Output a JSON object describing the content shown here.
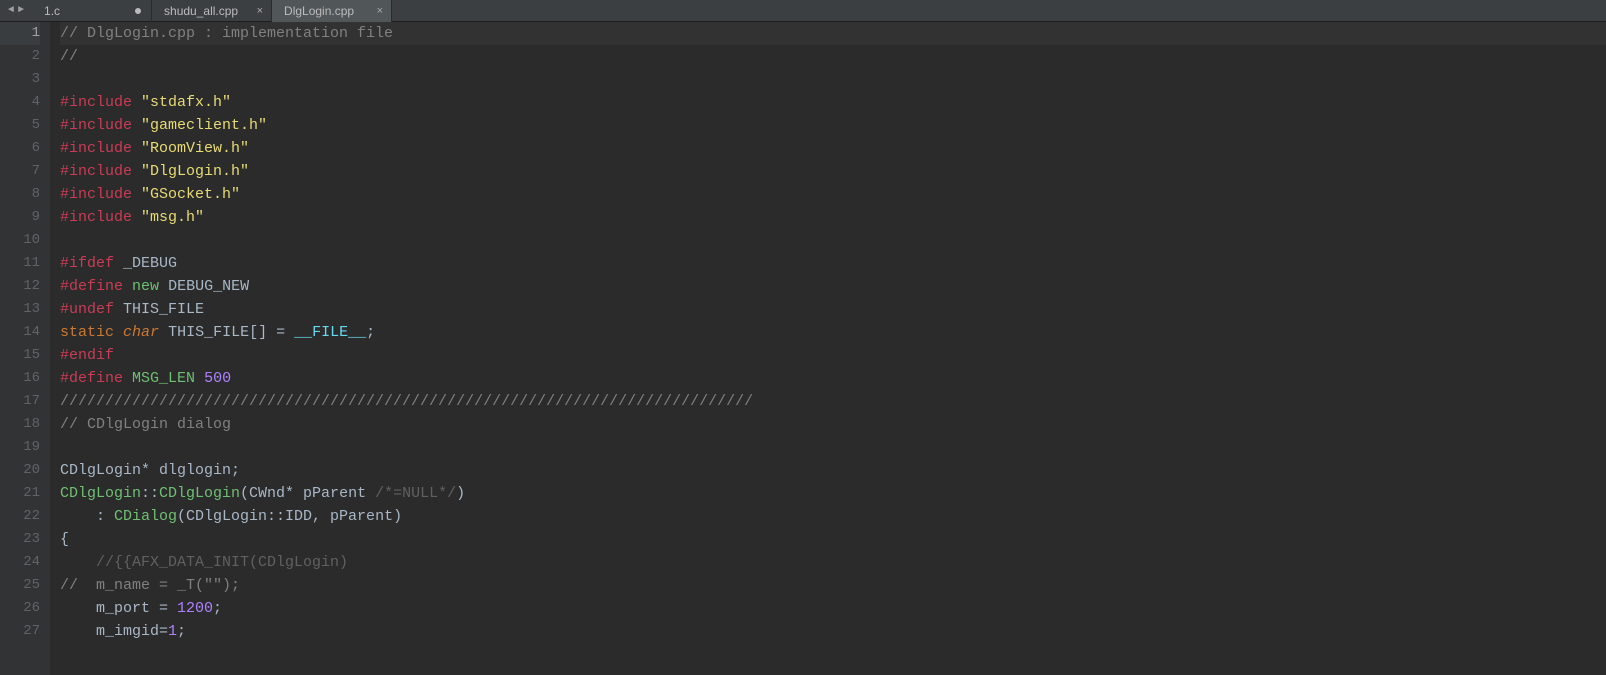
{
  "tabs": [
    {
      "label": "1.c",
      "modified": true,
      "active": false
    },
    {
      "label": "shudu_all.cpp",
      "modified": false,
      "active": false,
      "closable": true
    },
    {
      "label": "DlgLogin.cpp",
      "modified": false,
      "active": true,
      "closable": true
    }
  ],
  "code": {
    "lines": [
      {
        "n": 1,
        "tokens": [
          {
            "t": "// DlgLogin.cpp : implementation file",
            "c": "c-comment"
          }
        ],
        "active": true
      },
      {
        "n": 2,
        "tokens": [
          {
            "t": "//",
            "c": "c-comment"
          }
        ]
      },
      {
        "n": 3,
        "tokens": []
      },
      {
        "n": 4,
        "tokens": [
          {
            "t": "#include",
            "c": "c-preproc"
          },
          {
            "t": " ",
            "c": ""
          },
          {
            "t": "\"stdafx.h\"",
            "c": "c-string"
          }
        ]
      },
      {
        "n": 5,
        "tokens": [
          {
            "t": "#include",
            "c": "c-preproc"
          },
          {
            "t": " ",
            "c": ""
          },
          {
            "t": "\"gameclient.h\"",
            "c": "c-string"
          }
        ]
      },
      {
        "n": 6,
        "tokens": [
          {
            "t": "#include",
            "c": "c-preproc"
          },
          {
            "t": " ",
            "c": ""
          },
          {
            "t": "\"RoomView.h\"",
            "c": "c-string"
          }
        ]
      },
      {
        "n": 7,
        "tokens": [
          {
            "t": "#include",
            "c": "c-preproc"
          },
          {
            "t": " ",
            "c": ""
          },
          {
            "t": "\"DlgLogin.h\"",
            "c": "c-string"
          }
        ]
      },
      {
        "n": 8,
        "tokens": [
          {
            "t": "#include",
            "c": "c-preproc"
          },
          {
            "t": " ",
            "c": ""
          },
          {
            "t": "\"GSocket.h\"",
            "c": "c-string"
          }
        ]
      },
      {
        "n": 9,
        "tokens": [
          {
            "t": "#include",
            "c": "c-preproc"
          },
          {
            "t": " ",
            "c": ""
          },
          {
            "t": "\"msg.h\"",
            "c": "c-string"
          }
        ]
      },
      {
        "n": 10,
        "tokens": []
      },
      {
        "n": 11,
        "tokens": [
          {
            "t": "#ifdef",
            "c": "c-preproc"
          },
          {
            "t": " ",
            "c": ""
          },
          {
            "t": "_DEBUG",
            "c": "c-ident"
          }
        ]
      },
      {
        "n": 12,
        "tokens": [
          {
            "t": "#define",
            "c": "c-preproc"
          },
          {
            "t": " ",
            "c": ""
          },
          {
            "t": "new",
            "c": "c-define-name"
          },
          {
            "t": " ",
            "c": ""
          },
          {
            "t": "DEBUG_NEW",
            "c": "c-ident"
          }
        ]
      },
      {
        "n": 13,
        "tokens": [
          {
            "t": "#undef",
            "c": "c-preproc"
          },
          {
            "t": " ",
            "c": ""
          },
          {
            "t": "THIS_FILE",
            "c": "c-ident"
          }
        ]
      },
      {
        "n": 14,
        "tokens": [
          {
            "t": "static",
            "c": "c-keyword"
          },
          {
            "t": " ",
            "c": ""
          },
          {
            "t": "char",
            "c": "c-keyword-it"
          },
          {
            "t": " ",
            "c": ""
          },
          {
            "t": "THIS_FILE[] = ",
            "c": "c-ident"
          },
          {
            "t": "__FILE__",
            "c": "c-special"
          },
          {
            "t": ";",
            "c": "c-ident"
          }
        ]
      },
      {
        "n": 15,
        "tokens": [
          {
            "t": "#endif",
            "c": "c-preproc"
          }
        ]
      },
      {
        "n": 16,
        "tokens": [
          {
            "t": "#define",
            "c": "c-preproc"
          },
          {
            "t": " ",
            "c": ""
          },
          {
            "t": "MSG_LEN",
            "c": "c-define-name"
          },
          {
            "t": " ",
            "c": ""
          },
          {
            "t": "500",
            "c": "c-number"
          }
        ]
      },
      {
        "n": 17,
        "tokens": [
          {
            "t": "/////////////////////////////////////////////////////////////////////////////",
            "c": "c-comment"
          }
        ]
      },
      {
        "n": 18,
        "tokens": [
          {
            "t": "// CDlgLogin dialog",
            "c": "c-comment"
          }
        ]
      },
      {
        "n": 19,
        "tokens": []
      },
      {
        "n": 20,
        "tokens": [
          {
            "t": "CDlgLogin* dlglogin;",
            "c": "c-ident"
          }
        ]
      },
      {
        "n": 21,
        "tokens": [
          {
            "t": "CDlgLogin",
            "c": "c-type"
          },
          {
            "t": "::",
            "c": "c-ident"
          },
          {
            "t": "CDlgLogin",
            "c": "c-type"
          },
          {
            "t": "(CWnd* pParent ",
            "c": "c-ident"
          },
          {
            "t": "/*=NULL*/",
            "c": "c-comment-dim"
          },
          {
            "t": ")",
            "c": "c-ident"
          }
        ]
      },
      {
        "n": 22,
        "tokens": [
          {
            "t": "    : ",
            "c": "c-ident"
          },
          {
            "t": "CDialog",
            "c": "c-type"
          },
          {
            "t": "(CDlgLogin::IDD, pParent)",
            "c": "c-ident"
          }
        ]
      },
      {
        "n": 23,
        "tokens": [
          {
            "t": "{",
            "c": "c-ident"
          }
        ]
      },
      {
        "n": 24,
        "tokens": [
          {
            "t": "    ",
            "c": ""
          },
          {
            "t": "//{{AFX_DATA_INIT(CDlgLogin)",
            "c": "c-comment-dim"
          }
        ]
      },
      {
        "n": 25,
        "tokens": [
          {
            "t": "//  m_name = _T(\"\");",
            "c": "c-comment"
          }
        ]
      },
      {
        "n": 26,
        "tokens": [
          {
            "t": "    m_port = ",
            "c": "c-ident"
          },
          {
            "t": "1200",
            "c": "c-number"
          },
          {
            "t": ";",
            "c": "c-ident"
          }
        ]
      },
      {
        "n": 27,
        "tokens": [
          {
            "t": "    m_imgid=",
            "c": "c-ident"
          },
          {
            "t": "1",
            "c": "c-number"
          },
          {
            "t": ";",
            "c": "c-ident"
          }
        ]
      }
    ]
  }
}
